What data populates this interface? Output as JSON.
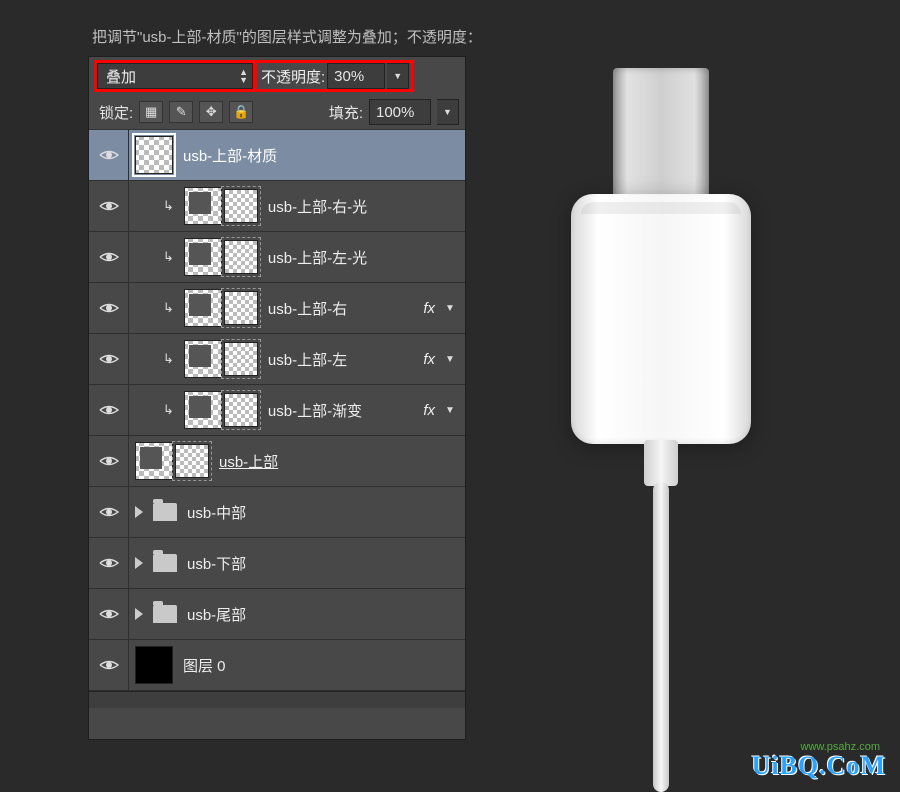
{
  "caption": "把调节\"usb-上部-材质\"的图层样式调整为叠加；不透明度：30%；",
  "blend": {
    "label": "叠加",
    "opacity_label": "不透明度:",
    "opacity_value": "30%"
  },
  "lock": {
    "label": "锁定:",
    "fill_label": "填充:",
    "fill_value": "100%"
  },
  "layers": [
    {
      "name": "usb-上部-材质",
      "type": "raster-selected"
    },
    {
      "name": "usb-上部-右-光",
      "type": "shape-clip"
    },
    {
      "name": "usb-上部-左-光",
      "type": "shape-clip"
    },
    {
      "name": "usb-上部-右",
      "type": "shape-clip-fx"
    },
    {
      "name": "usb-上部-左",
      "type": "shape-clip-fx"
    },
    {
      "name": "usb-上部-渐变",
      "type": "shape-clip-fx"
    },
    {
      "name": "usb-上部",
      "type": "shape-underline"
    },
    {
      "name": "usb-中部",
      "type": "group"
    },
    {
      "name": "usb-下部",
      "type": "group"
    },
    {
      "name": "usb-尾部",
      "type": "group"
    },
    {
      "name": "图层 0",
      "type": "solid"
    }
  ],
  "fx_label": "fx",
  "watermark": "UiBQ.CoM",
  "watermark_sub": "www.psahz.com"
}
